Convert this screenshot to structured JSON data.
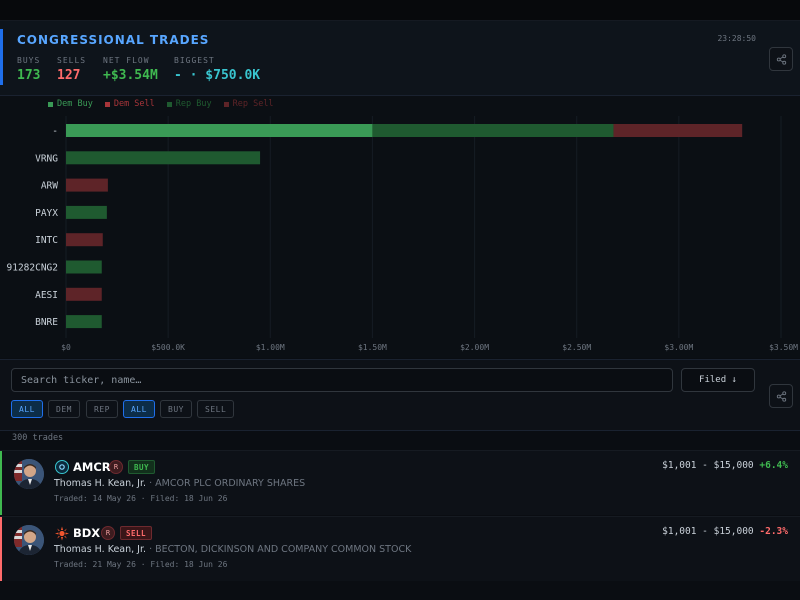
{
  "header": {
    "title": "CONGRESSIONAL TRADES",
    "time": "23:28:50",
    "stats": [
      {
        "label": "BUYS",
        "value": "173",
        "color": "#3fb950"
      },
      {
        "label": "SELLS",
        "value": "127",
        "color": "#ff6b6b"
      },
      {
        "label": "NET FLOW",
        "value": "+$3.54M",
        "color": "#3fb950"
      },
      {
        "label": "BIGGEST",
        "value": "- · $750.0K",
        "color": "#39c5cf"
      }
    ]
  },
  "legend": [
    {
      "label": "Dem Buy",
      "color": "#3a9a56"
    },
    {
      "label": "Dem Sell",
      "color": "#a8353a"
    },
    {
      "label": "Rep Buy",
      "color": "#1f5a30"
    },
    {
      "label": "Rep Sell",
      "color": "#5e2428"
    }
  ],
  "chart_data": {
    "type": "bar",
    "orientation": "horizontal",
    "stacked": true,
    "categories": [
      "-",
      "VRNG",
      "ARW",
      "PAYX",
      "INTC",
      "91282CNG2",
      "AESI",
      "BNRE"
    ],
    "series": [
      {
        "name": "Dem Buy",
        "values": [
          1500000,
          0,
          0,
          0,
          0,
          0,
          0,
          0
        ]
      },
      {
        "name": "Dem Sell",
        "values": [
          0,
          0,
          0,
          0,
          0,
          0,
          0,
          0
        ]
      },
      {
        "name": "Rep Buy",
        "values": [
          1180000,
          950000,
          0,
          200000,
          0,
          175000,
          0,
          175000
        ]
      },
      {
        "name": "Rep Sell",
        "values": [
          630000,
          0,
          205000,
          0,
          180000,
          0,
          175000,
          0
        ]
      }
    ],
    "xlim": [
      0,
      3500000
    ],
    "x_ticks": [
      0,
      500000,
      1000000,
      1500000,
      2000000,
      2500000,
      3000000,
      3500000
    ],
    "x_tick_labels": [
      "$0",
      "$500.0K",
      "$1.00M",
      "$1.50M",
      "$2.00M",
      "$2.50M",
      "$3.00M",
      "$3.50M"
    ],
    "grid": true,
    "legend_position": "top-left"
  },
  "controls": {
    "search_placeholder": "Search ticker, name…",
    "sort_label": "Filed ↓",
    "party_filters": [
      "ALL",
      "DEM",
      "REP"
    ],
    "type_filters": [
      "ALL",
      "BUY",
      "SELL"
    ]
  },
  "list": {
    "count_label": "300 trades",
    "trades": [
      {
        "ticker": "AMCR",
        "party": "R",
        "type": "BUY",
        "member": "Thomas H. Kean, Jr.",
        "separator": "·",
        "company": "AMCOR PLC ORDINARY SHARES",
        "traded": "Traded: 14 May 26",
        "filed": "Filed: 18 Jun 26",
        "dot": "·",
        "amount": "$1,001 - $15,000",
        "change": "+6.4%",
        "ticker_icon": "amcor-logo-icon"
      },
      {
        "ticker": "BDX",
        "party": "R",
        "type": "SELL",
        "member": "Thomas H. Kean, Jr.",
        "separator": "·",
        "company": "BECTON, DICKINSON AND COMPANY COMMON STOCK",
        "traded": "Traded: 21 May 26",
        "filed": "Filed: 18 Jun 26",
        "dot": "·",
        "amount": "$1,001 - $15,000",
        "change": "-2.3%",
        "ticker_icon": "bdx-logo-icon"
      }
    ]
  }
}
